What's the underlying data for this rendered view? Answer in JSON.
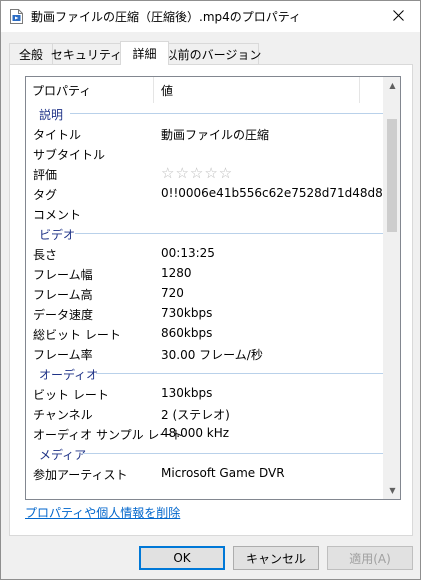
{
  "window": {
    "title": "動画ファイルの圧縮（圧縮後）.mp4のプロパティ"
  },
  "tabs": [
    {
      "label": "全般"
    },
    {
      "label": "セキュリティ"
    },
    {
      "label": "詳細"
    },
    {
      "label": "以前のバージョン"
    }
  ],
  "columns": {
    "property": "プロパティ",
    "value": "値"
  },
  "groups": {
    "description": "説明",
    "video": "ビデオ",
    "audio": "オーディオ",
    "media": "メディア"
  },
  "description_rows": [
    {
      "key": "タイトル",
      "value": "動画ファイルの圧縮"
    },
    {
      "key": "サブタイトル",
      "value": ""
    },
    {
      "key": "評価",
      "value": "☆☆☆☆☆"
    },
    {
      "key": "タグ",
      "value": "0!!0006e41b556c62e7528d71d48d8..."
    },
    {
      "key": "コメント",
      "value": ""
    }
  ],
  "video_rows": [
    {
      "key": "長さ",
      "value": "00:13:25"
    },
    {
      "key": "フレーム幅",
      "value": "1280"
    },
    {
      "key": "フレーム高",
      "value": "720"
    },
    {
      "key": "データ速度",
      "value": "730kbps"
    },
    {
      "key": "総ビット レート",
      "value": "860kbps"
    },
    {
      "key": "フレーム率",
      "value": "30.00 フレーム/秒"
    }
  ],
  "audio_rows": [
    {
      "key": "ビット レート",
      "value": "130kbps"
    },
    {
      "key": "チャンネル",
      "value": "2 (ステレオ)"
    },
    {
      "key": "オーディオ サンプル レート",
      "value": "48.000 kHz"
    }
  ],
  "media_rows": [
    {
      "key": "参加アーティスト",
      "value": "Microsoft Game DVR"
    }
  ],
  "rating": {
    "stars": 0,
    "max": 5
  },
  "footer": {
    "remove_link": "プロパティや個人情報を削除",
    "ok": "OK",
    "cancel": "キャンセル",
    "apply": "適用(A)"
  },
  "colors": {
    "group_header": "#1e3287",
    "link": "#0066cc",
    "default_button_border": "#0078d7"
  },
  "icons": {
    "title": "video-file-icon",
    "close": "close-icon",
    "scroll_up": "scroll-up-arrow-icon",
    "scroll_down": "scroll-down-arrow-icon"
  }
}
